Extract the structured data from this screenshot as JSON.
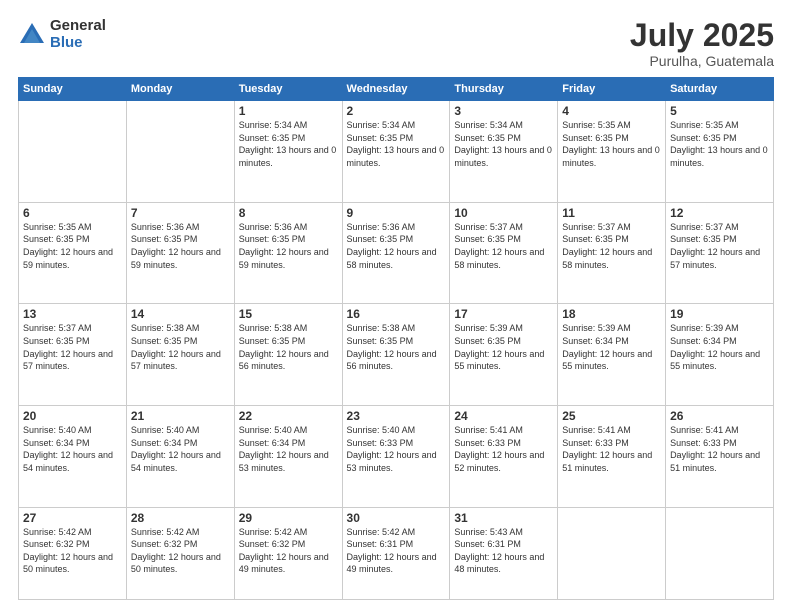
{
  "logo": {
    "general": "General",
    "blue": "Blue"
  },
  "title": "July 2025",
  "location": "Purulha, Guatemala",
  "weekdays": [
    "Sunday",
    "Monday",
    "Tuesday",
    "Wednesday",
    "Thursday",
    "Friday",
    "Saturday"
  ],
  "weeks": [
    [
      {
        "day": "",
        "sunrise": "",
        "sunset": "",
        "daylight": ""
      },
      {
        "day": "",
        "sunrise": "",
        "sunset": "",
        "daylight": ""
      },
      {
        "day": "1",
        "sunrise": "Sunrise: 5:34 AM",
        "sunset": "Sunset: 6:35 PM",
        "daylight": "Daylight: 13 hours and 0 minutes."
      },
      {
        "day": "2",
        "sunrise": "Sunrise: 5:34 AM",
        "sunset": "Sunset: 6:35 PM",
        "daylight": "Daylight: 13 hours and 0 minutes."
      },
      {
        "day": "3",
        "sunrise": "Sunrise: 5:34 AM",
        "sunset": "Sunset: 6:35 PM",
        "daylight": "Daylight: 13 hours and 0 minutes."
      },
      {
        "day": "4",
        "sunrise": "Sunrise: 5:35 AM",
        "sunset": "Sunset: 6:35 PM",
        "daylight": "Daylight: 13 hours and 0 minutes."
      },
      {
        "day": "5",
        "sunrise": "Sunrise: 5:35 AM",
        "sunset": "Sunset: 6:35 PM",
        "daylight": "Daylight: 13 hours and 0 minutes."
      }
    ],
    [
      {
        "day": "6",
        "sunrise": "Sunrise: 5:35 AM",
        "sunset": "Sunset: 6:35 PM",
        "daylight": "Daylight: 12 hours and 59 minutes."
      },
      {
        "day": "7",
        "sunrise": "Sunrise: 5:36 AM",
        "sunset": "Sunset: 6:35 PM",
        "daylight": "Daylight: 12 hours and 59 minutes."
      },
      {
        "day": "8",
        "sunrise": "Sunrise: 5:36 AM",
        "sunset": "Sunset: 6:35 PM",
        "daylight": "Daylight: 12 hours and 59 minutes."
      },
      {
        "day": "9",
        "sunrise": "Sunrise: 5:36 AM",
        "sunset": "Sunset: 6:35 PM",
        "daylight": "Daylight: 12 hours and 58 minutes."
      },
      {
        "day": "10",
        "sunrise": "Sunrise: 5:37 AM",
        "sunset": "Sunset: 6:35 PM",
        "daylight": "Daylight: 12 hours and 58 minutes."
      },
      {
        "day": "11",
        "sunrise": "Sunrise: 5:37 AM",
        "sunset": "Sunset: 6:35 PM",
        "daylight": "Daylight: 12 hours and 58 minutes."
      },
      {
        "day": "12",
        "sunrise": "Sunrise: 5:37 AM",
        "sunset": "Sunset: 6:35 PM",
        "daylight": "Daylight: 12 hours and 57 minutes."
      }
    ],
    [
      {
        "day": "13",
        "sunrise": "Sunrise: 5:37 AM",
        "sunset": "Sunset: 6:35 PM",
        "daylight": "Daylight: 12 hours and 57 minutes."
      },
      {
        "day": "14",
        "sunrise": "Sunrise: 5:38 AM",
        "sunset": "Sunset: 6:35 PM",
        "daylight": "Daylight: 12 hours and 57 minutes."
      },
      {
        "day": "15",
        "sunrise": "Sunrise: 5:38 AM",
        "sunset": "Sunset: 6:35 PM",
        "daylight": "Daylight: 12 hours and 56 minutes."
      },
      {
        "day": "16",
        "sunrise": "Sunrise: 5:38 AM",
        "sunset": "Sunset: 6:35 PM",
        "daylight": "Daylight: 12 hours and 56 minutes."
      },
      {
        "day": "17",
        "sunrise": "Sunrise: 5:39 AM",
        "sunset": "Sunset: 6:35 PM",
        "daylight": "Daylight: 12 hours and 55 minutes."
      },
      {
        "day": "18",
        "sunrise": "Sunrise: 5:39 AM",
        "sunset": "Sunset: 6:34 PM",
        "daylight": "Daylight: 12 hours and 55 minutes."
      },
      {
        "day": "19",
        "sunrise": "Sunrise: 5:39 AM",
        "sunset": "Sunset: 6:34 PM",
        "daylight": "Daylight: 12 hours and 55 minutes."
      }
    ],
    [
      {
        "day": "20",
        "sunrise": "Sunrise: 5:40 AM",
        "sunset": "Sunset: 6:34 PM",
        "daylight": "Daylight: 12 hours and 54 minutes."
      },
      {
        "day": "21",
        "sunrise": "Sunrise: 5:40 AM",
        "sunset": "Sunset: 6:34 PM",
        "daylight": "Daylight: 12 hours and 54 minutes."
      },
      {
        "day": "22",
        "sunrise": "Sunrise: 5:40 AM",
        "sunset": "Sunset: 6:34 PM",
        "daylight": "Daylight: 12 hours and 53 minutes."
      },
      {
        "day": "23",
        "sunrise": "Sunrise: 5:40 AM",
        "sunset": "Sunset: 6:33 PM",
        "daylight": "Daylight: 12 hours and 53 minutes."
      },
      {
        "day": "24",
        "sunrise": "Sunrise: 5:41 AM",
        "sunset": "Sunset: 6:33 PM",
        "daylight": "Daylight: 12 hours and 52 minutes."
      },
      {
        "day": "25",
        "sunrise": "Sunrise: 5:41 AM",
        "sunset": "Sunset: 6:33 PM",
        "daylight": "Daylight: 12 hours and 51 minutes."
      },
      {
        "day": "26",
        "sunrise": "Sunrise: 5:41 AM",
        "sunset": "Sunset: 6:33 PM",
        "daylight": "Daylight: 12 hours and 51 minutes."
      }
    ],
    [
      {
        "day": "27",
        "sunrise": "Sunrise: 5:42 AM",
        "sunset": "Sunset: 6:32 PM",
        "daylight": "Daylight: 12 hours and 50 minutes."
      },
      {
        "day": "28",
        "sunrise": "Sunrise: 5:42 AM",
        "sunset": "Sunset: 6:32 PM",
        "daylight": "Daylight: 12 hours and 50 minutes."
      },
      {
        "day": "29",
        "sunrise": "Sunrise: 5:42 AM",
        "sunset": "Sunset: 6:32 PM",
        "daylight": "Daylight: 12 hours and 49 minutes."
      },
      {
        "day": "30",
        "sunrise": "Sunrise: 5:42 AM",
        "sunset": "Sunset: 6:31 PM",
        "daylight": "Daylight: 12 hours and 49 minutes."
      },
      {
        "day": "31",
        "sunrise": "Sunrise: 5:43 AM",
        "sunset": "Sunset: 6:31 PM",
        "daylight": "Daylight: 12 hours and 48 minutes."
      },
      {
        "day": "",
        "sunrise": "",
        "sunset": "",
        "daylight": ""
      },
      {
        "day": "",
        "sunrise": "",
        "sunset": "",
        "daylight": ""
      }
    ]
  ]
}
